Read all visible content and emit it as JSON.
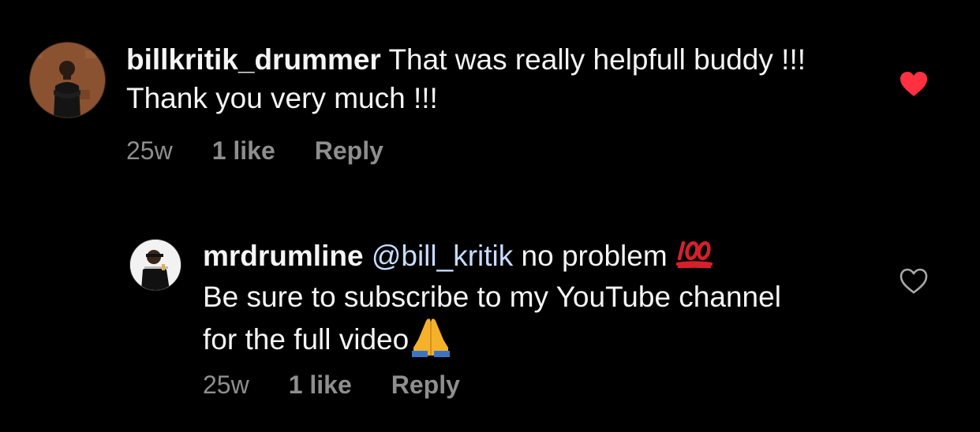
{
  "comments": [
    {
      "username": "billkritik_drummer",
      "text": " That was really helpfull buddy !!! Thank you very much !!!",
      "time": "25w",
      "likes": "1 like",
      "reply_label": "Reply",
      "liked": true,
      "heart_color": "#ff3040"
    },
    {
      "username": "mrdrumline",
      "mention": "@bill_kritik",
      "text_line1": " no problem ",
      "text_rest": "Be sure to subscribe to my YouTube channel for the full video",
      "time": "25w",
      "likes": "1 like",
      "reply_label": "Reply",
      "liked": false,
      "emoji_1": "hundred-points-icon",
      "emoji_2": "folded-hands-icon"
    }
  ],
  "colors": {
    "background": "#000000",
    "text": "#f5f5f5",
    "meta": "#8e8e8e",
    "mention": "#c7dcff",
    "liked_heart": "#ff3040"
  }
}
